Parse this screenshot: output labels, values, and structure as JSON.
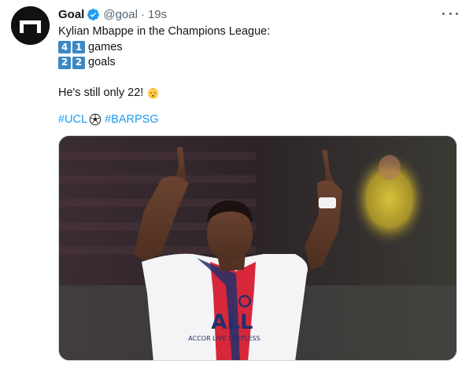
{
  "tweet": {
    "author_name": "Goal",
    "author_handle": "@goal",
    "separator": "·",
    "time": "19s",
    "line1": "Kylian Mbappe in the Champions League:",
    "games_digit1": "4",
    "games_digit2": "1",
    "games_label": "games",
    "goals_digit1": "2",
    "goals_digit2": "2",
    "goals_label": "goals",
    "age_text": "He's still only 22!",
    "hashtag1": "#UCL",
    "hashtag2": "#BARPSG",
    "verified_icon": "verified-badge-icon",
    "more_icon": "more-options-icon",
    "emoji_face": "baby-face-icon",
    "emoji_ball": "soccer-ball-icon"
  },
  "media": {
    "jersey_sponsor": "ACCOR LIVE LIMITLESS",
    "jersey_logo": "ALL"
  },
  "colors": {
    "link": "#1d9bf0",
    "verified": "#1d9bf0",
    "keycap": "#3b88c3",
    "secondary_text": "#536471"
  }
}
